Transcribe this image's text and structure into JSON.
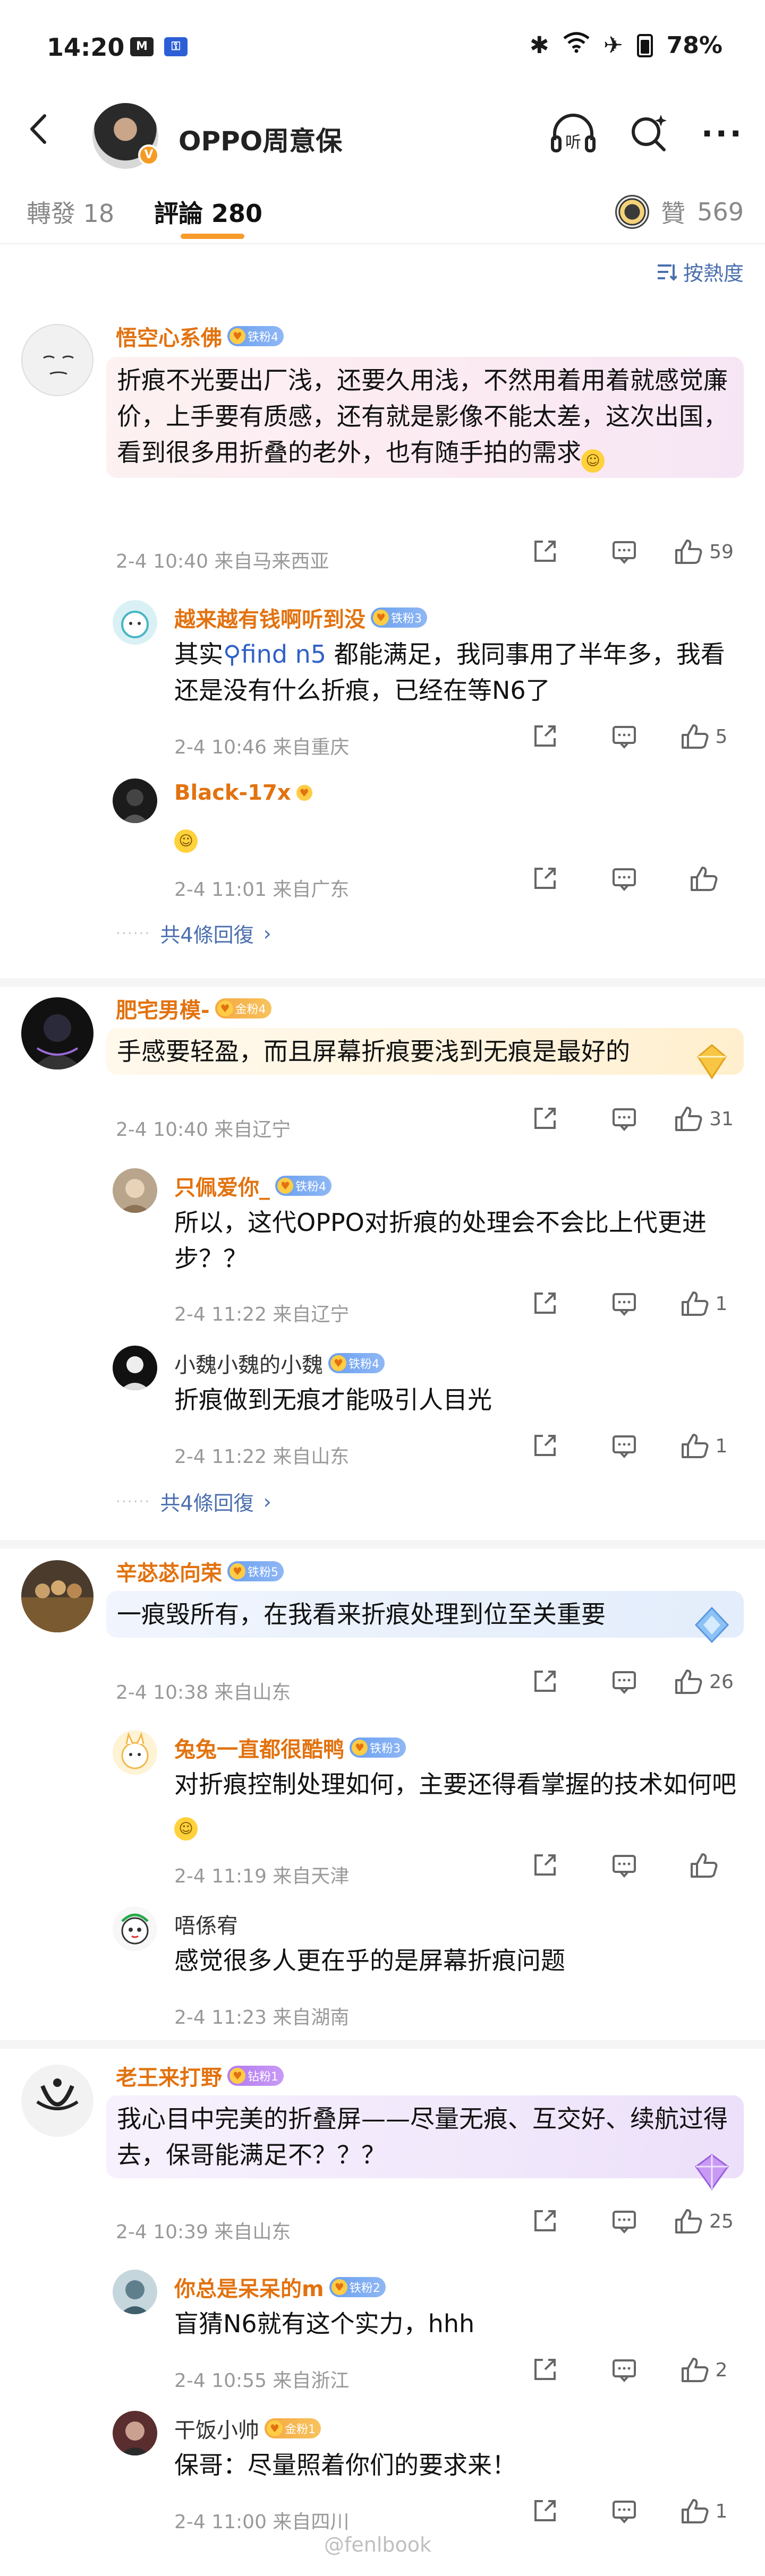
{
  "status": {
    "time": "14:20",
    "battery": "78%",
    "left_icons": [
      "M",
      "key-icon"
    ]
  },
  "header": {
    "title": "OPPO周意保",
    "listen_label": "听"
  },
  "tabs": {
    "reposts_label": "轉發",
    "reposts_count": "18",
    "comments_label": "評論",
    "comments_count": "280",
    "likes_label": "贊",
    "likes_count": "569"
  },
  "sort_label": "按熱度",
  "accent_color": "#e2720f",
  "link_color": "#4a6fae",
  "comments": [
    {
      "user": "悟空心系佛",
      "badge": "铁粉4",
      "text": "折痕不光要出厂浅，还要久用浅，不然用着用着就感觉廉价，上手要有质感，还有就是影像不能太差，这次出国，看到很多用折叠的老外，也有随手拍的需求",
      "meta": "2-4 10:40 来自马来西亚",
      "likes": "59",
      "replies": [
        {
          "user": "越来越有钱啊听到没",
          "badge": "铁粉3",
          "text_pre": "其实",
          "link": "find n5",
          "text_post": "都能满足，我同事用了半年多，我看还是没有什么折痕，已经在等N6了",
          "meta": "2-4 10:46 来自重庆",
          "likes": "5"
        },
        {
          "user": "Black-17x",
          "badge": "",
          "text": "",
          "meta": "2-4 11:01 来自广东",
          "likes": ""
        }
      ],
      "more": "共4條回復"
    },
    {
      "user": "肥宅男模-",
      "badge": "金粉4",
      "text": "手感要轻盈，而且屏幕折痕要浅到无痕是最好的",
      "meta": "2-4 10:40 来自辽宁",
      "likes": "31",
      "replies": [
        {
          "user": "只佩爱你_",
          "badge": "铁粉4",
          "text": "所以，这代OPPO对折痕的处理会不会比上代更进步？？",
          "meta": "2-4 11:22 来自辽宁",
          "likes": "1"
        },
        {
          "user": "小魏小魏的小魏",
          "badge": "铁粉4",
          "text": "折痕做到无痕才能吸引人目光",
          "meta": "2-4 11:22 来自山东",
          "likes": "1"
        }
      ],
      "more": "共4條回復"
    },
    {
      "user": "辛苾苾向荣",
      "badge": "铁粉5",
      "text": "一痕毁所有，在我看来折痕处理到位至关重要",
      "meta": "2-4 10:38 来自山东",
      "likes": "26",
      "replies": [
        {
          "user": "兔兔一直都很酷鸭",
          "badge": "铁粉3",
          "text": "对折痕控制处理如何，主要还得看掌握的技术如何吧",
          "meta": "2-4 11:19 来自天津",
          "likes": ""
        },
        {
          "user": "唔係宥",
          "badge": "",
          "text": "感觉很多人更在乎的是屏幕折痕问题",
          "meta": "2-4 11:23 来自湖南",
          "likes": ""
        }
      ]
    },
    {
      "user": "老王来打野",
      "badge": "钻粉1",
      "text": "我心目中完美的折叠屏——尽量无痕、互交好、续航过得去，保哥能满足不？？？",
      "meta": "2-4 10:39 来自山东",
      "likes": "25",
      "replies": [
        {
          "user": "你总是呆呆的m",
          "badge": "铁粉2",
          "text": "盲猜N6就有这个实力，hhh",
          "meta": "2-4 10:55 来自浙江",
          "likes": "2"
        },
        {
          "user": "干饭小帅",
          "badge": "金粉1",
          "text": "保哥：尽量照着你们的要求来！",
          "meta": "2-4 11:00 来自四川",
          "likes": "1"
        }
      ]
    }
  ],
  "watermark": "@fenlbook"
}
